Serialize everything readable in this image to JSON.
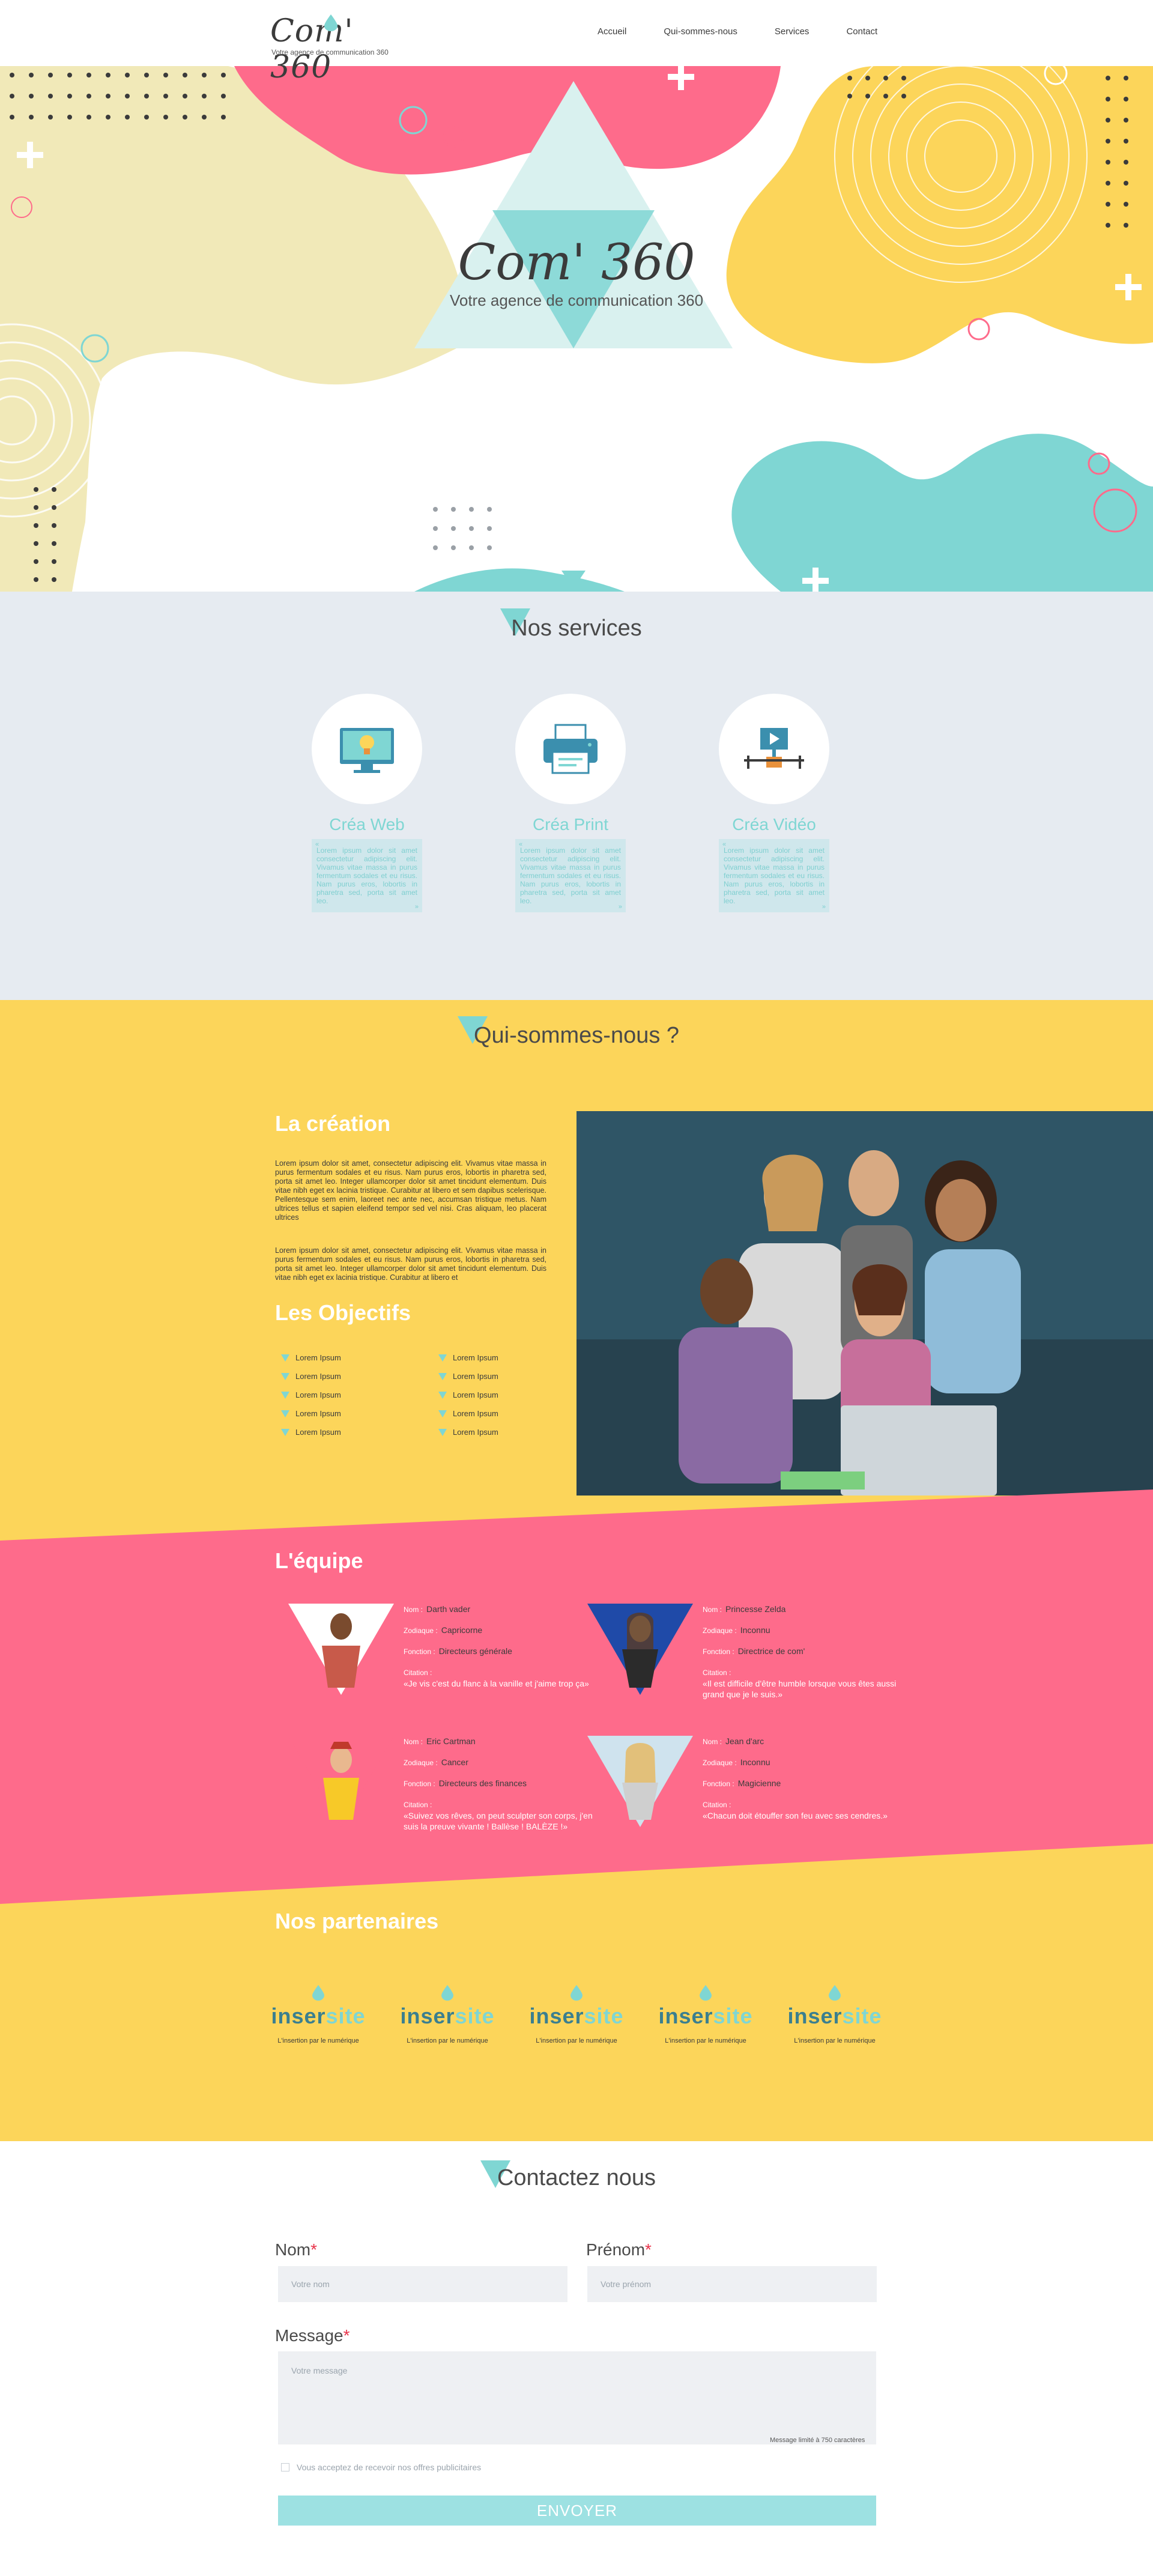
{
  "header": {
    "logo_text": "Com' 360",
    "logo_tagline": "Votre agence de communication 360",
    "nav": [
      "Accueil",
      "Qui-sommes-nous",
      "Services",
      "Contact"
    ]
  },
  "hero": {
    "title": "Com' 360",
    "subtitle": "Votre agence de communication 360"
  },
  "services": {
    "title": "Nos services",
    "items": [
      {
        "name": "Créa Web",
        "icon": "monitor-bulb-icon",
        "text": "Lorem ipsum dolor sit amet consectetur adipiscing elit. Vivamus vitae massa in purus fermentum sodales et eu risus. Nam purus eros, lobortis in pharetra sed, porta sit amet leo."
      },
      {
        "name": "Créa Print",
        "icon": "printer-icon",
        "text": "Lorem ipsum dolor sit amet consectetur adipiscing elit. Vivamus vitae massa in purus fermentum sodales et eu risus. Nam purus eros, lobortis in pharetra sed, porta sit amet leo."
      },
      {
        "name": "Créa Vidéo",
        "icon": "video-player-icon",
        "text": "Lorem ipsum dolor sit amet consectetur adipiscing elit. Vivamus vitae massa in purus fermentum sodales et eu risus. Nam purus eros, lobortis in pharetra sed, porta sit amet leo."
      }
    ],
    "quote_open": "«",
    "quote_close": "»"
  },
  "about": {
    "title": "Qui-sommes-nous ?",
    "creation_title": "La création",
    "creation_p1": "Lorem ipsum dolor sit amet, consectetur adipiscing elit. Vivamus vitae massa in purus fermentum sodales et eu risus. Nam purus eros, lobortis in pharetra sed, porta sit amet leo. Integer ullamcorper dolor sit amet tincidunt elementum. Duis vitae nibh eget ex lacinia tristique. Curabitur at libero et sem dapibus scelerisque. Pellentesque sem enim, laoreet nec ante nec, accumsan tristique metus. Nam ultrices tellus et sapien eleifend tempor sed vel nisi. Cras aliquam, leo placerat ultrices",
    "creation_p2": "Lorem ipsum dolor sit amet, consectetur adipiscing elit. Vivamus vitae massa in purus fermentum sodales et eu risus. Nam purus eros, lobortis in pharetra sed, porta sit amet leo. Integer ullamcorper dolor sit amet tincidunt elementum. Duis vitae nibh eget ex lacinia tristique. Curabitur at libero et",
    "objectives_title": "Les Objectifs",
    "objectives_left": [
      "Lorem Ipsum",
      "Lorem Ipsum",
      "Lorem Ipsum",
      "Lorem Ipsum",
      "Lorem Ipsum"
    ],
    "objectives_right": [
      "Lorem Ipsum",
      "Lorem Ipsum",
      "Lorem Ipsum",
      "Lorem Ipsum",
      "Lorem Ipsum"
    ]
  },
  "team": {
    "title": "L'équipe",
    "labels": {
      "name": "Nom :",
      "zodiac": "Zodiaque :",
      "role": "Fonction :",
      "quote": "Citation :"
    },
    "members": [
      {
        "name": "Darth vader",
        "zodiac": "Capricorne",
        "role": "Directeurs générale",
        "quote": "«Je vis c'est du flanc à la vanille et j'aime trop ça»"
      },
      {
        "name": "Princesse Zelda",
        "zodiac": "Inconnu",
        "role": "Directrice de com'",
        "quote": "«Il est difficile d'être humble lorsque vous êtes aussi grand que je le suis.»"
      },
      {
        "name": "Eric Cartman",
        "zodiac": "Cancer",
        "role": "Directeurs des finances",
        "quote": "«Suivez vos rêves, on peut sculpter son corps, j'en suis la preuve vivante ! Ballèse ! BALÈZE !»"
      },
      {
        "name": "Jean d'arc",
        "zodiac": "Inconnu",
        "role": "Magicienne",
        "quote": "«Chacun doit étouffer son feu avec ses cendres.»"
      }
    ]
  },
  "partners": {
    "title": "Nos partenaires",
    "items": [
      {
        "logo_a": "inser",
        "logo_b": "site",
        "tagline": "L'insertion par le numérique"
      },
      {
        "logo_a": "inser",
        "logo_b": "site",
        "tagline": "L'insertion par le numérique"
      },
      {
        "logo_a": "inser",
        "logo_b": "site",
        "tagline": "L'insertion par le numérique"
      },
      {
        "logo_a": "inser",
        "logo_b": "site",
        "tagline": "L'insertion par le numérique"
      },
      {
        "logo_a": "inser",
        "logo_b": "site",
        "tagline": "L'insertion par le numérique"
      }
    ]
  },
  "contact": {
    "title": "Contactez nous",
    "nom_label": "Nom",
    "prenom_label": "Prénom",
    "message_label": "Message",
    "required_mark": "*",
    "nom_placeholder": "Votre nom",
    "prenom_placeholder": "Votre prénom",
    "message_placeholder": "Votre message",
    "message_hint": "Message limité à 750 caractères",
    "consent_label": "Vous acceptez de recevoir nos offres publicitaires",
    "submit_label": "ENVOYER"
  },
  "colors": {
    "teal": "#7fd6d3",
    "pink": "#fe6b8b",
    "yellow": "#fcd55a",
    "light_grey": "#e6ebf1",
    "cream": "#f1e9b8"
  }
}
